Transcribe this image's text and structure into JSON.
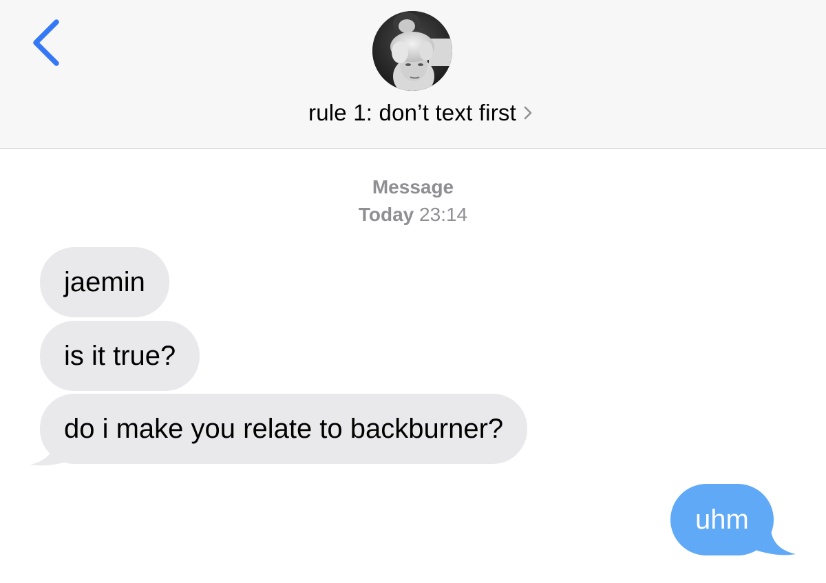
{
  "header": {
    "contact_name": "rule 1: don’t text first",
    "back_icon": "chevron-left-icon",
    "details_icon": "chevron-right-icon",
    "accent_color": "#3478f6"
  },
  "conversation": {
    "service_label": "Message",
    "day_label": "Today",
    "time_label": "23:14",
    "messages": [
      {
        "direction": "incoming",
        "text": "jaemin"
      },
      {
        "direction": "incoming",
        "text": "is it true?"
      },
      {
        "direction": "incoming",
        "text": "do i make you relate to backburner?"
      },
      {
        "direction": "outgoing",
        "text": "uhm"
      }
    ],
    "incoming_bubble_color": "#e9e9eb",
    "outgoing_bubble_color": "#5fa9f6"
  }
}
